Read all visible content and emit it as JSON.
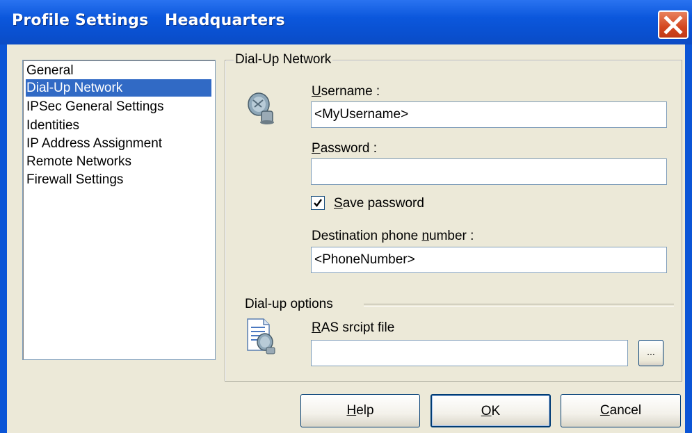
{
  "window": {
    "title": "Profile Settings   Headquarters",
    "close_icon": "close-icon"
  },
  "nav": {
    "items": [
      {
        "label": "General",
        "selected": false
      },
      {
        "label": "Dial-Up Network",
        "selected": true
      },
      {
        "label": "IPSec General Settings",
        "selected": false
      },
      {
        "label": "Identities",
        "selected": false
      },
      {
        "label": "IP Address Assignment",
        "selected": false
      },
      {
        "label": "Remote Networks",
        "selected": false
      },
      {
        "label": "Firewall Settings",
        "selected": false
      }
    ]
  },
  "panel": {
    "legend": "Dial-Up Network",
    "username": {
      "label_u": "U",
      "label_rest": "sername :",
      "value": "<MyUsername>"
    },
    "password": {
      "label_u": "P",
      "label_rest": "assword :",
      "value": ""
    },
    "save_password": {
      "label_u": "S",
      "label_rest": "ave password",
      "checked": true
    },
    "phone": {
      "label_pre": "Destination phone ",
      "label_u": "n",
      "label_rest": "umber :",
      "value": "<PhoneNumber>"
    },
    "dialup_options": "Dial-up options",
    "ras": {
      "label_u": "R",
      "label_rest": "AS srcipt file",
      "value": ""
    },
    "browse_label": "...",
    "icons": {
      "phone": "dialup-phone-icon",
      "script": "script-file-icon"
    }
  },
  "buttons": {
    "help": {
      "u": "H",
      "rest": "elp"
    },
    "ok": {
      "u": "O",
      "rest": "K"
    },
    "cancel": {
      "u": "C",
      "rest": "ancel"
    }
  },
  "colors": {
    "titlebar": "#0b57dc",
    "selection": "#316ac5",
    "face": "#ece9d8",
    "close": "#d3461f"
  }
}
